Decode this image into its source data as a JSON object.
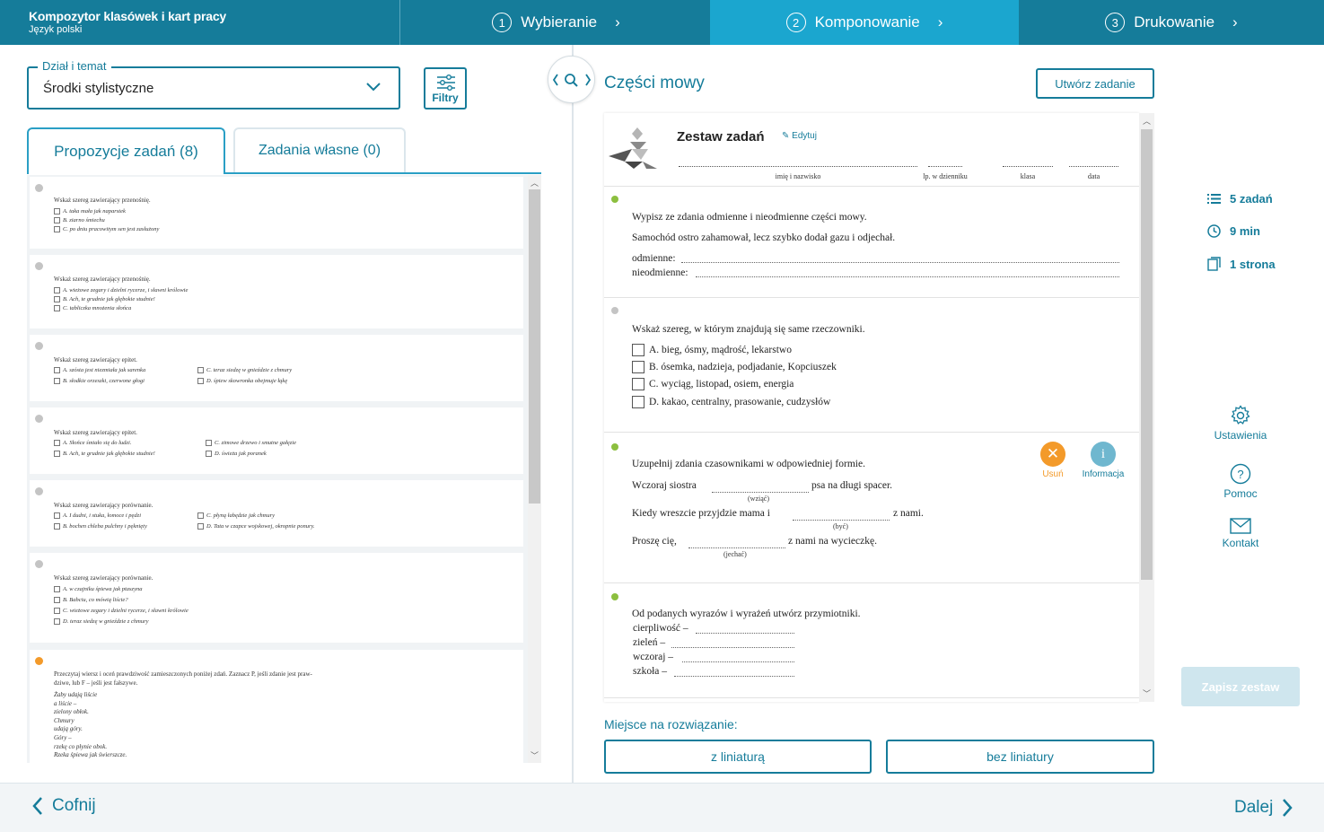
{
  "app": {
    "title": "Kompozytor klasówek i kart pracy",
    "subtitle": "Język polski"
  },
  "steps": [
    {
      "num": "1",
      "label": "Wybieranie"
    },
    {
      "num": "2",
      "label": "Komponowanie"
    },
    {
      "num": "3",
      "label": "Drukowanie"
    }
  ],
  "left": {
    "dzial_legend": "Dział i temat",
    "dzial_value": "Środki stylistyczne",
    "filtry_label": "Filtry",
    "tab_propozycje": "Propozycje zadań (8)",
    "tab_wlasne": "Zadania własne (0)",
    "tasks": [
      {
        "q": "Wskaż szereg zawierający przenośnię.",
        "opts": [
          "A.  taka mała jak naparstek",
          "B.  ziarno śmiechu",
          "C.  po dniu pracowitym sen jest zasłużony"
        ]
      },
      {
        "q": "Wskaż szereg zawierający przenośnię.",
        "opts": [
          "A.  wieżowe zegary i dzielni rycerze, i sławni królowie",
          "B.  Ach, te grudnie jak głębokie studnie!",
          "C.  tabliczka mnożenia słońca"
        ]
      },
      {
        "q": "Wskaż szereg zawierający epitet.",
        "opts": [
          "A.  szósta jest niezmiała jak sarenka",
          "B.  słodkie orzeszki, czerwone głogi",
          "C.  teraz siedzę w gnieździe z chmury",
          "D.  śpiew skowronka obejmuje łąkę"
        ]
      },
      {
        "q": "Wskaż szereg zawierający epitet.",
        "opts": [
          "A.  Słońce śmiało się do ludzi.",
          "B.  Ach, te grudnie jak głębokie studnie!",
          "C.  zimowe drzewo i smutne gałęzie",
          "D.  świeża jak poranek"
        ]
      },
      {
        "q": "Wskaż szereg zawierający porównanie.",
        "opts": [
          "A.  I dudni, i stuka, łomoce i pędzi",
          "B.  bochen chleba pulchny i pęknięty",
          "C.  płyną łabędzie jak chmury",
          "D.  Tata w czapce wojskowej, okropnie ponury."
        ]
      },
      {
        "q": "Wskaż szereg zawierający porównanie.",
        "opts": [
          "A.  w czajniku śpiewa jak ptaszyna",
          "B.  Babciu, co mówią liście?",
          "C.  wieżowe zegary i dzielni rycerze, i sławni królowie",
          "D.  teraz siedzę w gnieździe z chmury"
        ]
      },
      {
        "q": "Przeczytaj wiersz i oceń prawdziwość zamieszczonych poniżej zdań. Zaznacz P, jeśli zdanie jest praw-",
        "q2": "dziwe, lub F – jeśli jest fałszywe.",
        "poem": [
          "Żaby udają liście",
          "a liście –",
          "zielony obłok.",
          "Chmury",
          "udają góry.",
          "Góry –",
          "rzekę co płynie obok.",
          "Rzeka śpiewa jak świerszcze."
        ]
      }
    ]
  },
  "right": {
    "title": "Części mowy",
    "utworz_label": "Utwórz zadanie",
    "zestaw_title": "Zestaw zadań",
    "edytuj_label": "Edytuj",
    "header_fields": [
      "imię i nazwisko",
      "lp. w dzienniku",
      "klasa",
      "data"
    ],
    "q1": {
      "text": "Wypisz ze zdania odmienne i nieodmienne części mowy.",
      "sentence": "Samochód ostro zahamował, lecz szybko dodał gazu i odjechał.",
      "line1": "odmienne:",
      "line2": "nieodmienne:"
    },
    "q2": {
      "text": "Wskaż szereg, w którym znajdują się same rzeczowniki.",
      "opts": [
        "A. bieg, ósmy, mądrość, lekarstwo",
        "B. ósemka, nadzieja, podjadanie, Kopciuszek",
        "C. wyciąg, listopad, osiem, energia",
        "D. kakao, centralny, prasowanie, cudzysłów"
      ]
    },
    "q3": {
      "text": "Uzupełnij zdania czasownikami w odpowiedniej formie.",
      "s1a": "Wczoraj siostra",
      "s1b": "psa na długi spacer.",
      "s1h": "(wziąć)",
      "s2a": "Kiedy wreszcie przyjdzie mama i",
      "s2b": "z nami.",
      "s2h": "(być)",
      "s3a": "Proszę cię,",
      "s3b": "z nami na wycieczkę.",
      "s3h": "(jechać)",
      "usun": "Usuń",
      "informacja": "Informacja"
    },
    "q4": {
      "text": "Od podanych wyrazów i wyrażeń utwórz przymiotniki.",
      "words": [
        "cierpliwość –",
        "zieleń –",
        "wczoraj –",
        "szkoła –"
      ]
    },
    "miejsce_label": "Miejsce na rozwiązanie:",
    "z_liniatura": "z liniaturą",
    "bez_liniatury": "bez liniatury"
  },
  "stats": {
    "zadan": "5 zadań",
    "czas": "9 min",
    "strony": "1 strona"
  },
  "side": {
    "ustawienia": "Ustawienia",
    "pomoc": "Pomoc",
    "kontakt": "Kontakt",
    "zapisz": "Zapisz zestaw"
  },
  "nav": {
    "back": "Cofnij",
    "next": "Dalej"
  },
  "colors": {
    "primary": "#157c9a",
    "active_step": "#1ba6cf",
    "orange": "#f39a2a",
    "green": "#8cbf3f"
  }
}
